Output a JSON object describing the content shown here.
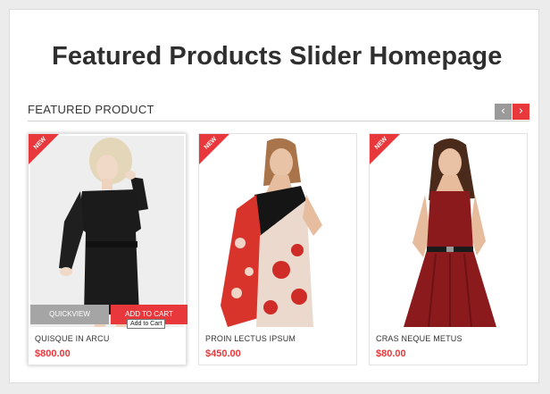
{
  "page": {
    "title": "Featured Products Slider Homepage"
  },
  "section": {
    "title": "FEATURED PRODUCT",
    "prev_icon": "‹",
    "next_icon": "›"
  },
  "colors": {
    "accent": "#e8383b",
    "muted": "#a5a5a5"
  },
  "products": [
    {
      "badge": "NEW",
      "name": "QUISQUE IN ARCU",
      "price": "$800.00",
      "quickview": "QUICKVIEW",
      "add_to_cart": "ADD TO CART",
      "tooltip": "Add to Cart"
    },
    {
      "badge": "NEW",
      "name": "PROIN LECTUS IPSUM",
      "price": "$450.00"
    },
    {
      "badge": "NEW",
      "name": "CRAS NEQUE METUS",
      "price": "$80.00"
    }
  ]
}
